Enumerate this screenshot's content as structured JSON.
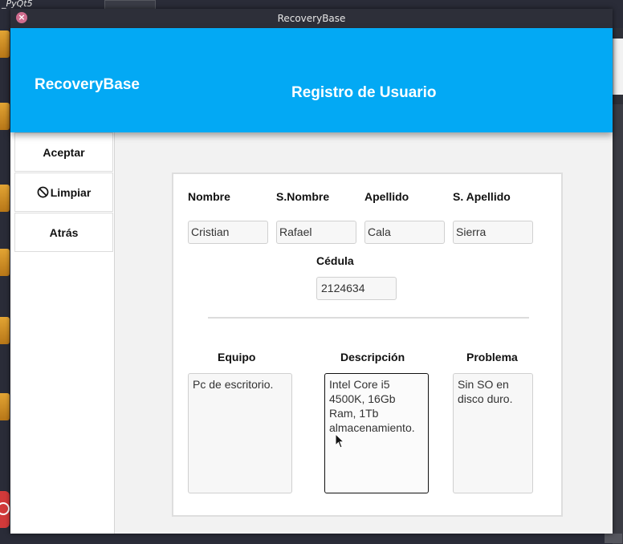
{
  "desktop": {
    "title_fragment": "_PyQt5"
  },
  "window": {
    "title": "RecoveryBase",
    "close_glyph": "×"
  },
  "header": {
    "brand": "RecoveryBase",
    "title": "Registro de Usuario"
  },
  "sidebar": {
    "accept": "Aceptar",
    "clear": "Limpiar",
    "back": "Atrás"
  },
  "form": {
    "labels": {
      "nombre": "Nombre",
      "snombre": "S.Nombre",
      "apellido": "Apellido",
      "sapellido": "S. Apellido",
      "cedula": "Cédula",
      "equipo": "Equipo",
      "descripcion": "Descripción",
      "problema": "Problema"
    },
    "values": {
      "nombre": "Cristian",
      "snombre": "Rafael",
      "apellido": "Cala",
      "sapellido": "Sierra",
      "cedula": "2124634",
      "equipo": "Pc de escritorio.",
      "descripcion": "Intel Core i5\n4500K, 16Gb\nRam, 1Tb\nalmacenamiento.",
      "problema": "Sin SO en\ndisco duro."
    }
  },
  "colors": {
    "header": "#03a9f4",
    "titlebar": "#2d2f39",
    "content_bg": "#f2f2f2"
  }
}
